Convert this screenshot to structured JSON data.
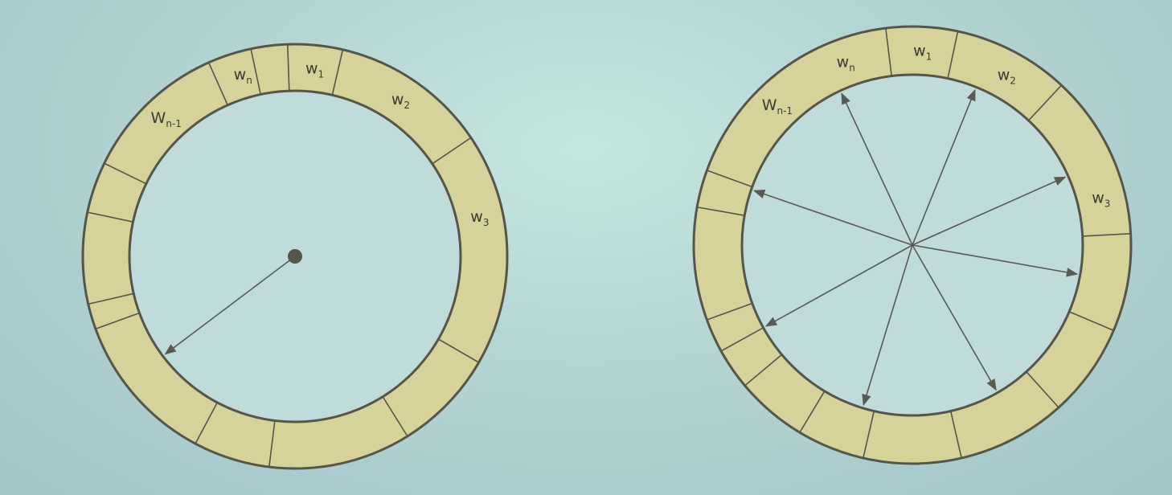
{
  "colors": {
    "ring_fill": "#d6d39a",
    "ring_stroke": "#55554a",
    "inner_fill": "#bfdcda",
    "arrow": "#5a5a55",
    "center_dot": "#55554f"
  },
  "diagrams": [
    {
      "id": "single-pointer-wheel",
      "segments": [
        {
          "name": "w",
          "sub": "1"
        },
        {
          "name": "w",
          "sub": "2"
        },
        {
          "name": "w",
          "sub": "3"
        },
        {
          "name": "",
          "sub": ""
        },
        {
          "name": "",
          "sub": ""
        },
        {
          "name": "",
          "sub": ""
        },
        {
          "name": "",
          "sub": ""
        },
        {
          "name": "",
          "sub": ""
        },
        {
          "name": "",
          "sub": ""
        },
        {
          "name": "",
          "sub": ""
        },
        {
          "name": "",
          "sub": ""
        },
        {
          "name": "W",
          "sub": "n-1"
        },
        {
          "name": "w",
          "sub": "n"
        }
      ],
      "pointers": 1
    },
    {
      "id": "multi-pointer-wheel",
      "segments": [
        {
          "name": "w",
          "sub": "1"
        },
        {
          "name": "w",
          "sub": "2"
        },
        {
          "name": "w",
          "sub": "3"
        },
        {
          "name": "",
          "sub": ""
        },
        {
          "name": "",
          "sub": ""
        },
        {
          "name": "",
          "sub": ""
        },
        {
          "name": "",
          "sub": ""
        },
        {
          "name": "",
          "sub": ""
        },
        {
          "name": "",
          "sub": ""
        },
        {
          "name": "",
          "sub": ""
        },
        {
          "name": "",
          "sub": ""
        },
        {
          "name": "",
          "sub": ""
        },
        {
          "name": "W",
          "sub": "n-1"
        },
        {
          "name": "w",
          "sub": "n"
        }
      ],
      "pointers": 8
    }
  ]
}
